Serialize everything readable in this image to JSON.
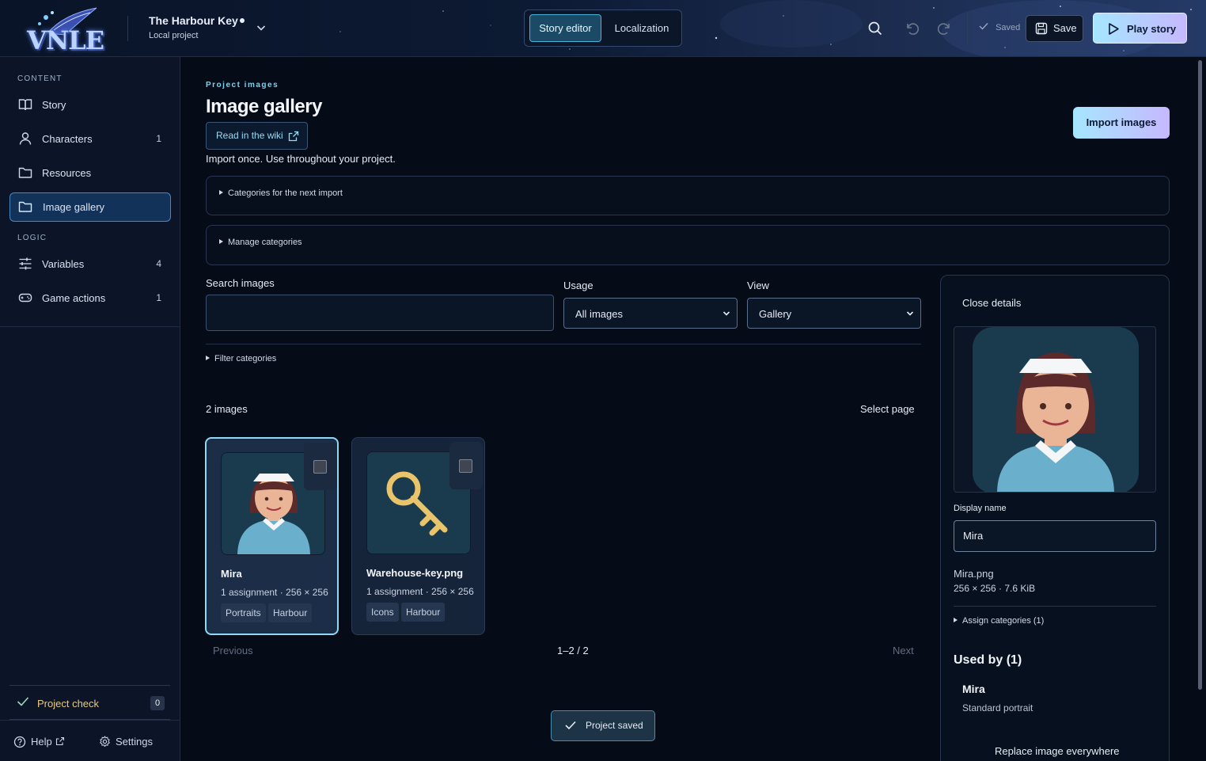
{
  "app": {
    "logo_text": "VNLE",
    "project_title": "The Harbour Key",
    "project_subtitle": "Local project"
  },
  "topbar": {
    "tabs": [
      {
        "label": "Story editor",
        "active": true
      },
      {
        "label": "Localization",
        "active": false
      }
    ],
    "icons": [
      "search-icon",
      "undo-icon",
      "redo-icon"
    ],
    "saved_label": "Saved",
    "save_label": "Save",
    "play_label": "Play story"
  },
  "sidebar": {
    "content_heading": "CONTENT",
    "logic_heading": "LOGIC",
    "items": [
      {
        "label": "Story",
        "count": "",
        "icon": "book-icon"
      },
      {
        "label": "Characters",
        "count": "1",
        "icon": "user-icon"
      },
      {
        "label": "Resources",
        "count": "",
        "icon": "folder-icon"
      },
      {
        "label": "Image gallery",
        "count": "",
        "icon": "folder-icon",
        "active": true
      },
      {
        "label": "Variables",
        "count": "4",
        "icon": "sliders-icon"
      },
      {
        "label": "Game actions",
        "count": "1",
        "icon": "gamepad-icon"
      }
    ],
    "project_check": {
      "label": "Project check",
      "count": "0"
    },
    "help_label": "Help",
    "settings_label": "Settings"
  },
  "main": {
    "eyebrow": "Project images",
    "title": "Image gallery",
    "wiki_label": "Read in the wiki",
    "description": "Import once. Use throughout your project.",
    "import_label": "Import images",
    "categories_next_import": "Categories for the next import",
    "manage_categories": "Manage categories",
    "search_label": "Search images",
    "search_value": "",
    "usage_label": "Usage",
    "usage_value": "All images",
    "view_label": "View",
    "view_value": "Gallery",
    "filter_categories": "Filter categories",
    "count_label": "2 images",
    "select_page": "Select page",
    "cards": [
      {
        "name": "Mira",
        "meta": "1 assignment · 256 × 256",
        "tags": [
          "Portraits",
          "Harbour"
        ],
        "selected": true
      },
      {
        "name": "Warehouse-key.png",
        "meta": "1 assignment · 256 × 256",
        "tags": [
          "Icons",
          "Harbour"
        ],
        "selected": false
      }
    ],
    "pagination": {
      "prev": "Previous",
      "range": "1–2 / 2",
      "next": "Next"
    },
    "toast": "Project saved"
  },
  "details": {
    "close_label": "Close details",
    "display_name_label": "Display name",
    "display_name_value": "Mira",
    "file_name": "Mira.png",
    "file_meta": "256 × 256 · 7.6 KiB",
    "assign_categories": "Assign categories (1)",
    "used_by_title": "Used by (1)",
    "used_by_name": "Mira",
    "used_by_sub": "Standard portrait",
    "replace_label": "Replace image everywhere"
  },
  "colors": {
    "accent": "#7ad3f2",
    "gradient_start": "#a6e6ff",
    "gradient_end": "#c6b8ff",
    "warning": "#e7c985"
  }
}
